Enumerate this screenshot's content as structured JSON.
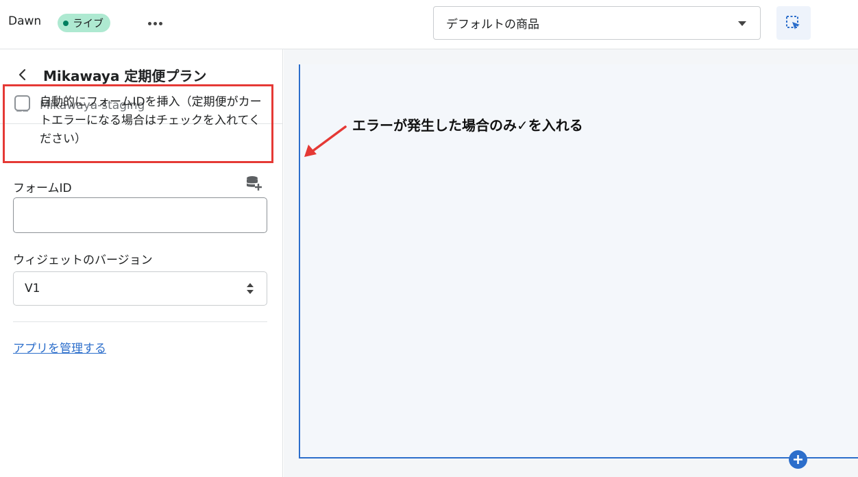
{
  "topbar": {
    "theme_name": "Dawn",
    "live_badge": "ライブ",
    "product_select_value": "デフォルトの商品",
    "more_icon": "ellipsis-horizontal-icon",
    "inspector_icon": "select-cursor-icon"
  },
  "sidebar": {
    "back_icon": "chevron-left-icon",
    "block_title": "Mikawaya 定期便プラン",
    "app_icon": "app-blocks-icon",
    "app_name": "Mikawaya-staging",
    "auto_insert_checkbox": {
      "checked": false,
      "label": "自動的にフォームIDを挿入（定期便がカートエラーになる場合はチェックを入れてください）"
    },
    "form_id": {
      "label": "フォームID",
      "value": "",
      "dynamic_source_icon": "database-plus-icon"
    },
    "widget_version": {
      "label": "ウィジェットのバージョン",
      "selected": "V1"
    },
    "manage_app_link": "アプリを管理する"
  },
  "preview": {
    "annotation": "エラーが発生した場合のみ✓を入れる",
    "add_icon": "plus-circle-icon"
  },
  "colors": {
    "accent": "#2c6ecb",
    "live_badge_bg": "#aee9d1",
    "live_dot": "#007f5f",
    "highlight": "#e53935"
  }
}
